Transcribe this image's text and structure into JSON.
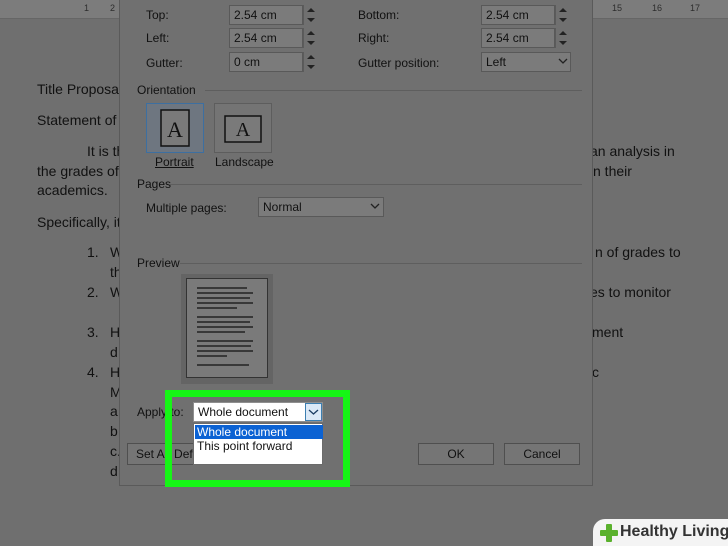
{
  "ruler": {
    "ticks": [
      "1",
      "1",
      "2",
      "15",
      "16",
      "17"
    ]
  },
  "document": {
    "lines": [
      "Title Proposal",
      "Statement of",
      "It is th",
      "an analysis in",
      "the grades of",
      "n their",
      "academics.",
      "Specifically, it",
      "1.",
      "W",
      "n of grades to",
      "th",
      "2.",
      "W",
      "es to monitor",
      "3.",
      "H",
      "ment",
      "d",
      "4.",
      "H",
      "c",
      "M",
      "a.",
      "b.",
      "c.",
      "d"
    ]
  },
  "dialog": {
    "margins": {
      "top_label": "Top:",
      "top_value": "2.54 cm",
      "bottom_label": "Bottom:",
      "bottom_value": "2.54 cm",
      "left_label": "Left:",
      "left_value": "2.54 cm",
      "right_label": "Right:",
      "right_value": "2.54 cm",
      "gutter_label": "Gutter:",
      "gutter_value": "0 cm",
      "gutter_pos_label": "Gutter position:",
      "gutter_pos_value": "Left"
    },
    "orientation": {
      "title": "Orientation",
      "portrait": "Portrait",
      "landscape": "Landscape",
      "glyph": "A"
    },
    "pages": {
      "title": "Pages",
      "multiple_label": "Multiple pages:",
      "multiple_value": "Normal"
    },
    "preview": {
      "title": "Preview"
    },
    "apply": {
      "label": "Apply to:",
      "value": "Whole document",
      "options": [
        "Whole document",
        "This point forward"
      ]
    },
    "buttons": {
      "set_default": "Set As Default",
      "ok": "OK",
      "cancel": "Cancel"
    }
  },
  "brand": {
    "name": "Healthy Living"
  },
  "colors": {
    "highlight": "#16f516",
    "selection": "#0b62d3",
    "brand_green": "#5ab12d"
  }
}
